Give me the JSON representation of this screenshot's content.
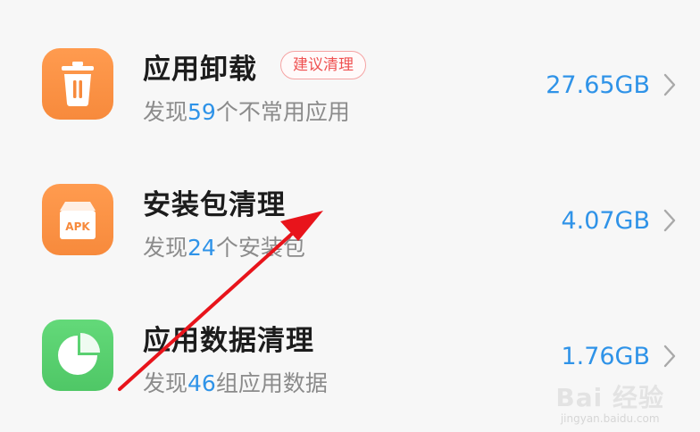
{
  "items": [
    {
      "title": "应用卸载",
      "badge": "建议清理",
      "sub_prefix": "发现",
      "sub_number": "59",
      "sub_suffix": "个不常用应用",
      "size": "27.65GB",
      "icon": "trash-icon",
      "icon_color": "#f78a3c"
    },
    {
      "title": "安装包清理",
      "sub_prefix": "发现",
      "sub_number": "24",
      "sub_suffix": "个安装包",
      "size": "4.07GB",
      "icon": "apk-box-icon",
      "icon_label": "APK",
      "icon_color": "#f78a3c"
    },
    {
      "title": "应用数据清理",
      "sub_prefix": "发现",
      "sub_number": "46",
      "sub_suffix": "组应用数据",
      "size": "1.76GB",
      "icon": "pie-chart-icon",
      "icon_color": "#4fc766"
    }
  ],
  "colors": {
    "accent_blue": "#2f93e8",
    "badge_red": "#ef5151",
    "annotation_arrow": "#e8141b"
  },
  "watermark": {
    "logo": "Bai 经验",
    "url": "jingyan.baidu.com"
  }
}
